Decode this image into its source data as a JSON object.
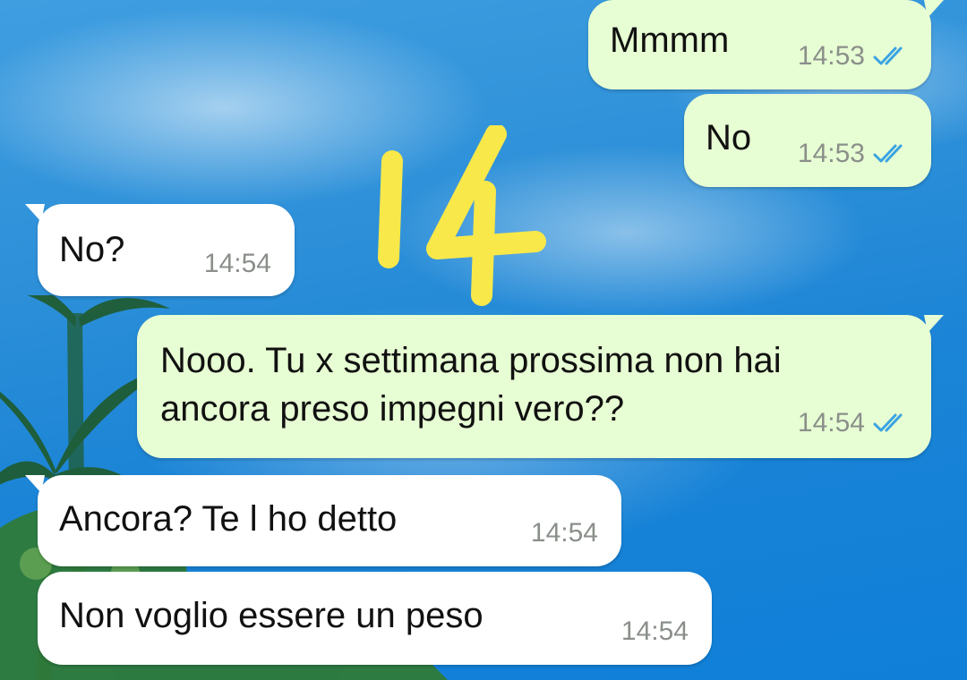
{
  "chat": {
    "messages": [
      {
        "direction": "outgoing",
        "text": "Mmmm",
        "time": "14:53",
        "status": "read-double-check-icon"
      },
      {
        "direction": "outgoing",
        "text": "No",
        "time": "14:53",
        "status": "read-double-check-icon"
      },
      {
        "direction": "incoming",
        "text": "No?",
        "time": "14:54"
      },
      {
        "direction": "outgoing",
        "text": "Nooo. Tu x settimana prossima non hai\nancora preso impegni vero??",
        "time": "14:54",
        "status": "read-double-check-icon"
      },
      {
        "direction": "incoming",
        "text": "Ancora? Te l ho detto",
        "time": "14:54"
      },
      {
        "direction": "incoming",
        "text": "Non voglio essere un peso",
        "time": "14:54"
      }
    ]
  },
  "overlay": {
    "sticker_text": "14",
    "sticker_color": "#f9e84a"
  },
  "colors": {
    "outgoing_bubble": "#e7fdd3",
    "incoming_bubble": "#ffffff",
    "read_ticks": "#3aa3e3",
    "timestamp": "#8a8f8a"
  }
}
